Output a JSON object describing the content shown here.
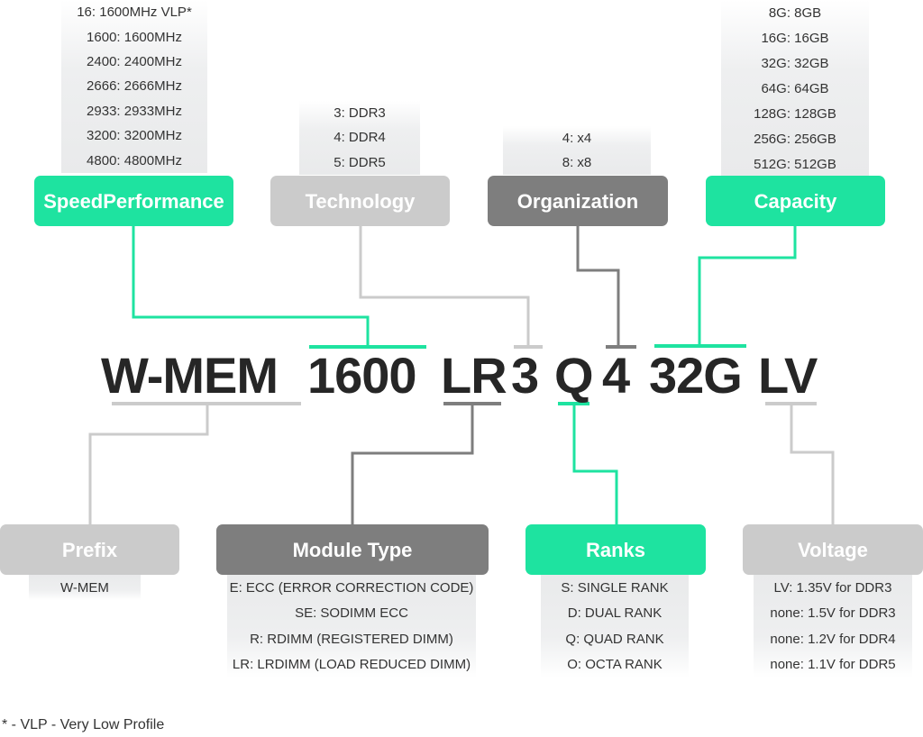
{
  "colors": {
    "green": "#1ee3a0",
    "light_gray": "#cbcbcb",
    "dark_gray": "#7e7e7e",
    "text": "#262626"
  },
  "code_segments": [
    "W-MEM",
    "1600",
    "LR",
    "3",
    "Q",
    "4",
    "32G",
    "LV"
  ],
  "top_categories": [
    {
      "id": "speed",
      "title_lines": [
        "Speed",
        "Performance"
      ],
      "color": "green",
      "segment": "1600",
      "options": [
        "16: 1600MHz VLP*",
        "1600: 1600MHz",
        "2400: 2400MHz",
        "2666: 2666MHz",
        "2933: 2933MHz",
        "3200: 3200MHz",
        "4800: 4800MHz"
      ]
    },
    {
      "id": "technology",
      "title_lines": [
        "Technology"
      ],
      "color": "light_gray",
      "segment": "3",
      "options": [
        "3: DDR3",
        "4: DDR4",
        "5: DDR5"
      ]
    },
    {
      "id": "organization",
      "title_lines": [
        "Organization"
      ],
      "color": "dark_gray",
      "segment": "4",
      "options": [
        "4: x4",
        "8: x8"
      ]
    },
    {
      "id": "capacity",
      "title_lines": [
        "Capacity"
      ],
      "color": "green",
      "segment": "32G",
      "options": [
        "8G: 8GB",
        "16G: 16GB",
        "32G: 32GB",
        "64G: 64GB",
        "128G: 128GB",
        "256G: 256GB",
        "512G: 512GB"
      ]
    }
  ],
  "bottom_categories": [
    {
      "id": "prefix",
      "title_lines": [
        "Prefix"
      ],
      "color": "light_gray",
      "segment": "W-MEM",
      "options": [
        "W-MEM"
      ]
    },
    {
      "id": "module-type",
      "title_lines": [
        "Module Type"
      ],
      "color": "dark_gray",
      "segment": "LR",
      "options": [
        "E: ECC (ERROR CORRECTION CODE)",
        "SE: SODIMM ECC",
        "R: RDIMM (REGISTERED DIMM)",
        "LR: LRDIMM (LOAD REDUCED DIMM)"
      ]
    },
    {
      "id": "ranks",
      "title_lines": [
        "Ranks"
      ],
      "color": "green",
      "segment": "Q",
      "options": [
        "S: SINGLE RANK",
        "D: DUAL RANK",
        "Q: QUAD RANK",
        "O: OCTA RANK"
      ]
    },
    {
      "id": "voltage",
      "title_lines": [
        "Voltage"
      ],
      "color": "light_gray",
      "segment": "LV",
      "options": [
        "LV: 1.35V for DDR3",
        "none: 1.5V for DDR3",
        "none: 1.2V for DDR4",
        "none: 1.1V for DDR5"
      ]
    }
  ],
  "footnote": "* - VLP - Very Low Profile"
}
